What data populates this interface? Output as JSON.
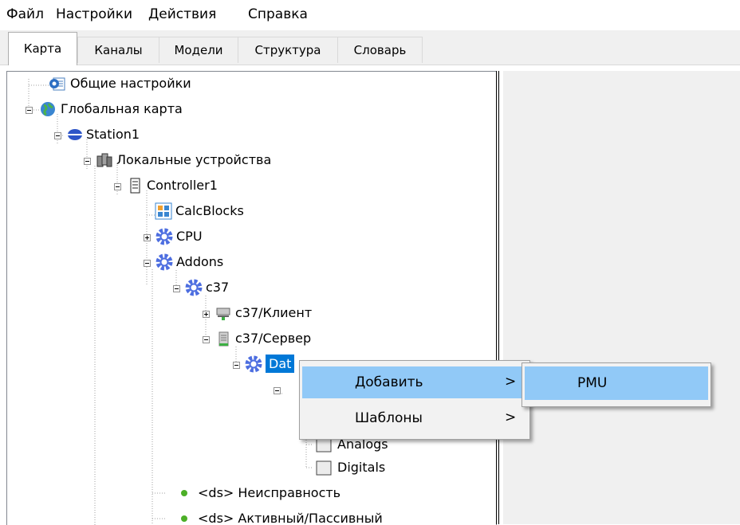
{
  "menubar": {
    "items": [
      "Файл",
      "Настройки",
      "Действия",
      "Справка"
    ]
  },
  "tabs": [
    {
      "label": "Карта",
      "active": true
    },
    {
      "label": "Каналы",
      "active": false
    },
    {
      "label": "Модели",
      "active": false
    },
    {
      "label": "Структура",
      "active": false
    },
    {
      "label": "Словарь",
      "active": false
    }
  ],
  "tree": {
    "general_settings": {
      "label": "Общие настройки",
      "icon": "settings-doc-icon"
    },
    "global_map": {
      "label": "Глобальная карта",
      "icon": "globe-icon"
    },
    "station": {
      "label": "Station1",
      "icon": "station-disc-icon"
    },
    "local_devices": {
      "label": "Локальные устройства",
      "icon": "devices-icon"
    },
    "controller": {
      "label": "Controller1",
      "icon": "server-icon"
    },
    "calcblocks": {
      "label": "CalcBlocks",
      "icon": "blocks-icon"
    },
    "cpu": {
      "label": "CPU",
      "icon": "gear-icon"
    },
    "addons": {
      "label": "Addons",
      "icon": "gear-icon"
    },
    "c37": {
      "label": "c37",
      "icon": "gear-icon"
    },
    "c37_client": {
      "label": "c37/Клиент",
      "icon": "client-icon"
    },
    "c37_server": {
      "label": "c37/Сервер",
      "icon": "server-icon"
    },
    "selected_node": {
      "label": "Dat",
      "icon": "gear-icon"
    },
    "analogs": {
      "label": "Analogs",
      "icon": "folder-box-icon"
    },
    "digitals": {
      "label": "Digitals",
      "icon": "folder-box-icon"
    },
    "ds_fault": {
      "label": "<ds> Неисправность",
      "icon": "green-dot-icon"
    },
    "ds_active": {
      "label": "<ds> Активный/Пассивный",
      "icon": "green-dot-icon"
    }
  },
  "context_menu": {
    "items": [
      {
        "label": "Добавить",
        "arrow": ">",
        "highlighted": true
      },
      {
        "label": "Шаблоны",
        "arrow": ">",
        "highlighted": false
      }
    ],
    "submenu": {
      "items": [
        {
          "label": "PMU",
          "highlighted": true
        }
      ]
    }
  },
  "colors": {
    "selection": "#0078d7",
    "menu_highlight": "#91c9f7",
    "green_dot": "#4caf27"
  }
}
